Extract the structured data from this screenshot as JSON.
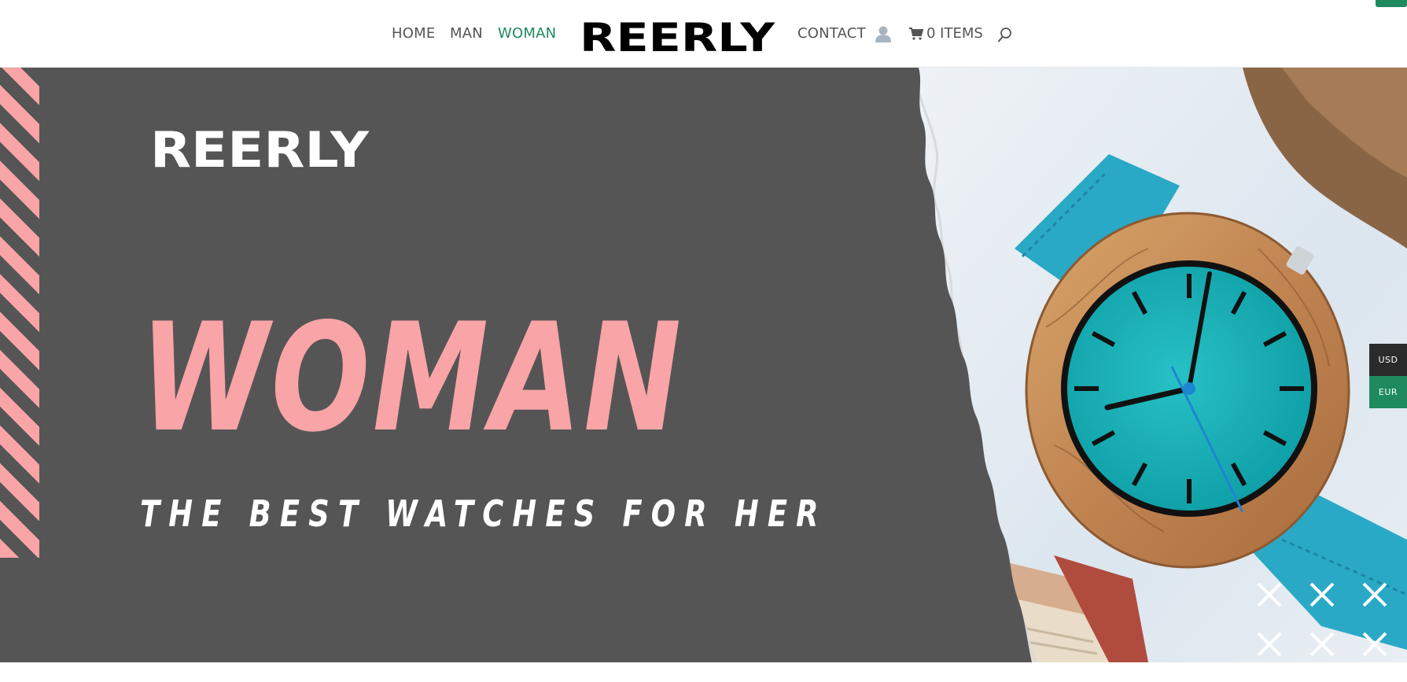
{
  "header": {
    "nav_left": [
      {
        "label": "HOME"
      },
      {
        "label": "MAN"
      },
      {
        "label": "WOMAN",
        "active": true
      }
    ],
    "logo_text": "REERLY",
    "nav_right": [
      {
        "label": "CONTACT"
      }
    ],
    "cart_label": "0 ITEMS",
    "icons": [
      "user-icon",
      "cart-icon",
      "search-icon"
    ],
    "accent_color": "#1e8a5d"
  },
  "hero": {
    "logo_text": "REERLY",
    "title": "WOMAN",
    "subtitle": "THE BEST WATCHES FOR HER",
    "background_color": "#555556",
    "title_color": "#f9a4a6",
    "decor_icons": [
      "close-x-icon"
    ]
  },
  "currency_switcher": {
    "options": [
      {
        "label": "USD",
        "color": "#2b2b2b"
      },
      {
        "label": "EUR",
        "color": "#1e8a5d"
      }
    ]
  }
}
